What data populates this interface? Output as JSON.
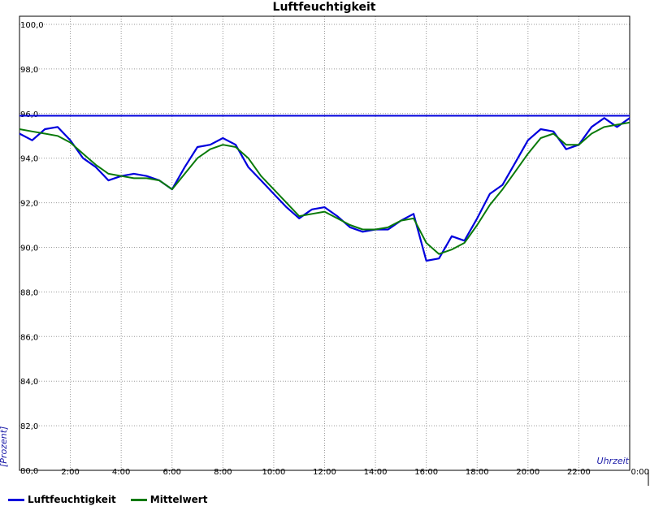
{
  "chart_data": {
    "type": "line",
    "title": "Luftfeuchtigkeit",
    "xlabel": "Uhrzeit",
    "ylabel": "[Prozent]",
    "ylim": [
      80,
      100
    ],
    "xlim": [
      0,
      24
    ],
    "y_ticks": [
      "80,0",
      "82,0",
      "84,0",
      "86,0",
      "88,0",
      "90,0",
      "92,0",
      "94,0",
      "96,0",
      "98,0",
      "100,0"
    ],
    "x_ticks": [
      "2:00",
      "4:00",
      "6:00",
      "8:00",
      "10:00",
      "12:00",
      "14:00",
      "16:00",
      "18:00",
      "20:00",
      "22:00",
      "0:00"
    ],
    "grid": true,
    "legend_position": "bottom-left",
    "reference_line": {
      "y": 95.9,
      "color": "#0000dd"
    },
    "series": [
      {
        "name": "Luftfeuchtigkeit",
        "color": "#0000dd",
        "x": [
          0,
          0.5,
          1,
          1.5,
          2,
          2.5,
          3,
          3.5,
          4,
          4.5,
          5,
          5.5,
          6,
          6.5,
          7,
          7.5,
          8,
          8.5,
          9,
          9.5,
          10,
          10.5,
          11,
          11.5,
          12,
          12.5,
          13,
          13.5,
          14,
          14.5,
          15,
          15.5,
          16,
          16.5,
          17,
          17.5,
          18,
          18.5,
          19,
          19.5,
          20,
          20.5,
          21,
          21.5,
          22,
          22.5,
          23,
          23.5,
          24
        ],
        "y": [
          95.1,
          94.8,
          95.3,
          95.4,
          94.8,
          94.0,
          93.6,
          93.0,
          93.2,
          93.3,
          93.2,
          93.0,
          92.6,
          93.6,
          94.5,
          94.6,
          94.9,
          94.6,
          93.6,
          93.0,
          92.4,
          91.8,
          91.3,
          91.7,
          91.8,
          91.4,
          90.9,
          90.7,
          90.8,
          90.8,
          91.2,
          91.5,
          89.4,
          89.5,
          90.5,
          90.3,
          91.3,
          92.4,
          92.8,
          93.8,
          94.8,
          95.3,
          95.2,
          94.4,
          94.6,
          95.4,
          95.8,
          95.4,
          95.8
        ]
      },
      {
        "name": "Mittelwert",
        "color": "#0a7a0a",
        "x": [
          0,
          0.5,
          1,
          1.5,
          2,
          2.5,
          3,
          3.5,
          4,
          4.5,
          5,
          5.5,
          6,
          6.5,
          7,
          7.5,
          8,
          8.5,
          9,
          9.5,
          10,
          10.5,
          11,
          11.5,
          12,
          12.5,
          13,
          13.5,
          14,
          14.5,
          15,
          15.5,
          16,
          16.5,
          17,
          17.5,
          18,
          18.5,
          19,
          19.5,
          20,
          20.5,
          21,
          21.5,
          22,
          22.5,
          23,
          23.5,
          24
        ],
        "y": [
          95.3,
          95.2,
          95.1,
          95.0,
          94.7,
          94.2,
          93.7,
          93.3,
          93.2,
          93.1,
          93.1,
          93.0,
          92.6,
          93.3,
          94.0,
          94.4,
          94.6,
          94.5,
          94.0,
          93.2,
          92.6,
          92.0,
          91.4,
          91.5,
          91.6,
          91.3,
          91.0,
          90.8,
          90.8,
          90.9,
          91.2,
          91.3,
          90.2,
          89.7,
          89.9,
          90.2,
          91.0,
          91.9,
          92.6,
          93.4,
          94.2,
          94.9,
          95.1,
          94.6,
          94.6,
          95.1,
          95.4,
          95.5,
          95.6
        ]
      }
    ]
  }
}
